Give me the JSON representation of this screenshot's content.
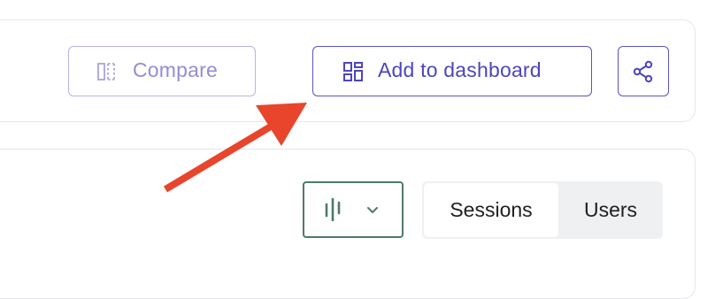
{
  "toolbar": {
    "compare_label": "Compare",
    "add_to_dashboard_label": "Add to dashboard"
  },
  "view_toggle": {
    "options": [
      {
        "label": "Sessions",
        "selected": true
      },
      {
        "label": "Users",
        "selected": false
      }
    ]
  },
  "icons": {
    "compare": "split-view-icon",
    "dashboard": "dashboard-grid-icon",
    "share": "share-icon",
    "chart_type": "candlestick-chart-icon",
    "dropdown": "chevron-down-icon"
  },
  "colors": {
    "accent": "#4c45bd",
    "accent_disabled": "#948dd3",
    "chart_select_border": "#4e7a68",
    "annotation_arrow": "#e8452c"
  }
}
